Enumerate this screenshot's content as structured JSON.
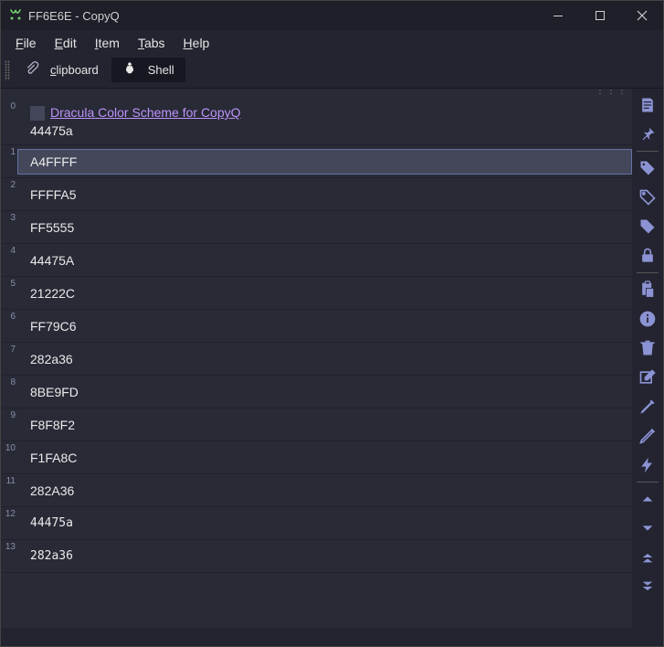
{
  "window": {
    "title": "FF6E6E - CopyQ"
  },
  "menu": {
    "file": "File",
    "edit": "Edit",
    "item": "Item",
    "tabs": "Tabs",
    "help": "Help"
  },
  "tabs": {
    "clipboard": "clipboard",
    "shell": "Shell"
  },
  "items": [
    {
      "idx": "0",
      "link": "Dracula Color Scheme for CopyQ",
      "sub": "44475a",
      "first": true
    },
    {
      "idx": "1",
      "text": "A4FFFF",
      "selected": true
    },
    {
      "idx": "2",
      "text": "FFFFA5"
    },
    {
      "idx": "3",
      "text": "FF5555"
    },
    {
      "idx": "4",
      "text": "44475A"
    },
    {
      "idx": "5",
      "text": "21222C"
    },
    {
      "idx": "6",
      "text": "FF79C6"
    },
    {
      "idx": "7",
      "text": "282a36"
    },
    {
      "idx": "8",
      "text": "8BE9FD"
    },
    {
      "idx": "9",
      "text": "F8F8F2"
    },
    {
      "idx": "10",
      "text": "F1FA8C"
    },
    {
      "idx": "11",
      "text": "282A36"
    },
    {
      "idx": "12",
      "text": "44475a",
      "mono": true
    },
    {
      "idx": "13",
      "text": "282a36",
      "mono": true
    }
  ],
  "colors": {
    "accent": "#8c93d4",
    "link": "#bd93f9",
    "selection": "#44475a"
  }
}
